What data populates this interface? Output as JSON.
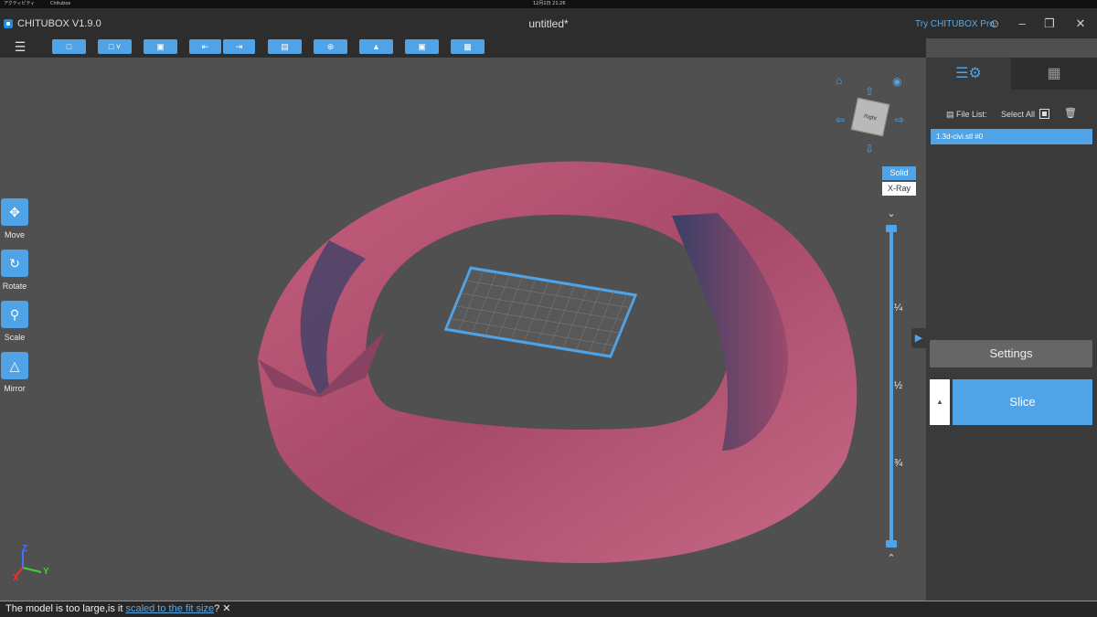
{
  "sysbar": {
    "left1": "アクティビティ",
    "left2": "Chitubox",
    "center": "12月1日 21:26",
    "center2": "CHITUBOX"
  },
  "window": {
    "app_name": "CHITUBOX V1.9.0",
    "doc_title": "untitled*",
    "pro_link": "Try CHITUBOX Pro"
  },
  "toolbar": {
    "buttons": [
      "open-folder-icon",
      "save-icon",
      "select-icon",
      "import-icon",
      "export-icon",
      "document-icon",
      "arrange-icon",
      "support-icon",
      "hollow-icon",
      "print-icon"
    ]
  },
  "left_tools": [
    {
      "label": "Move",
      "icon": "move-icon"
    },
    {
      "label": "Rotate",
      "icon": "rotate-icon"
    },
    {
      "label": "Scale",
      "icon": "scale-icon"
    },
    {
      "label": "Mirror",
      "icon": "mirror-icon"
    }
  ],
  "view_modes": {
    "solid": "Solid",
    "xray": "X-Ray",
    "active": "Solid"
  },
  "nav_cube": {
    "face_label": "Right"
  },
  "slider_fractions": [
    "¼",
    "½",
    "¾"
  ],
  "axes": {
    "x": "X",
    "y": "Y",
    "z": "Z"
  },
  "right_panel": {
    "file_list_label": "File List:",
    "select_all_label": "Select All",
    "files": [
      "1.3d-civi.stl #0"
    ],
    "settings_label": "Settings",
    "slice_label": "Slice"
  },
  "status": {
    "prefix": "The model is too large,is it ",
    "link": "scaled to the fit size",
    "suffix": "?"
  },
  "colors": {
    "accent": "#4fa3e6",
    "model": "#b8566f"
  }
}
